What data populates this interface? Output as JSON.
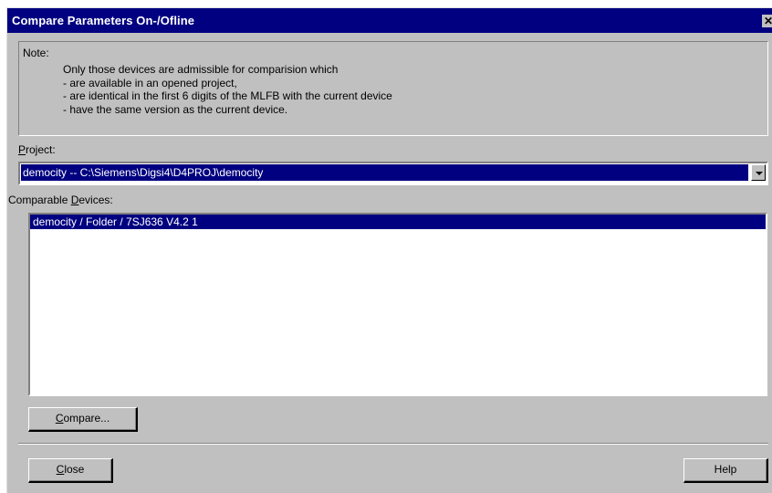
{
  "window": {
    "title": "Compare Parameters On-/Ofline",
    "close_glyph": "✕"
  },
  "note": {
    "label": "Note:",
    "lines": [
      "Only those devices are admissible for comparision which",
      "- are available in an opened project,",
      "- are identical in the first 6 digits of the MLFB with the current device",
      "- have the same version as the current device."
    ]
  },
  "project": {
    "label_accel": "P",
    "label_rest": "roject:",
    "value": "democity -- C:\\Siemens\\Digsi4\\D4PROJ\\democity"
  },
  "devices": {
    "label_pre": "Comparable ",
    "label_accel": "D",
    "label_rest": "evices:",
    "items": [
      {
        "label": "democity / Folder / 7SJ636 V4.2 1",
        "selected": true
      }
    ]
  },
  "buttons": {
    "compare": {
      "accel": "C",
      "rest": "ompare..."
    },
    "close": {
      "accel": "C",
      "rest": "lose"
    },
    "help": "Help"
  },
  "colors": {
    "titlebar": "#000080",
    "dialog_face": "#c0c0c0",
    "selection": "#000080"
  },
  "icons": {
    "combo_dropdown": "triangle-down"
  }
}
